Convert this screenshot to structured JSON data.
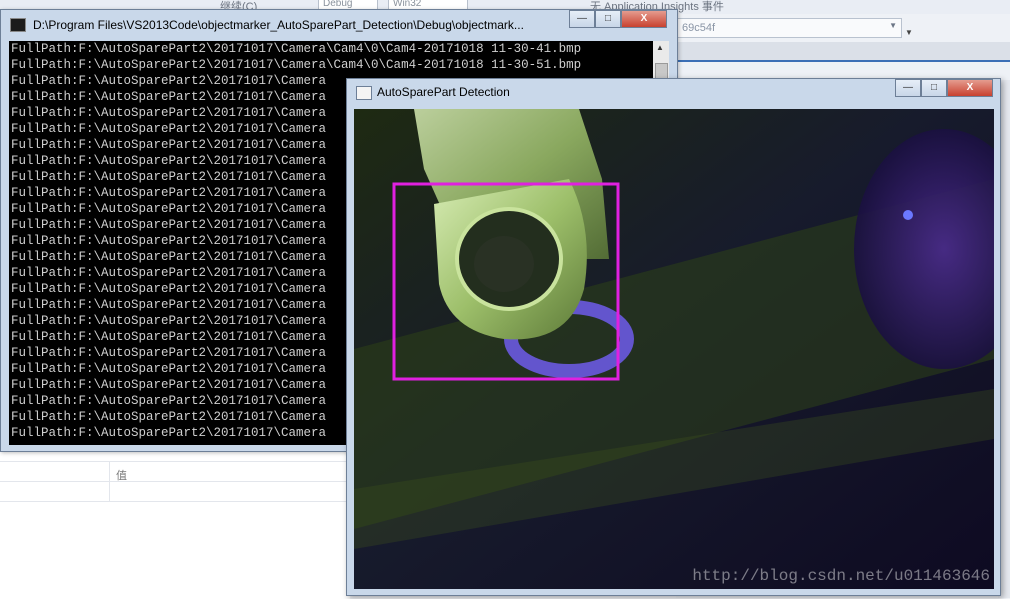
{
  "ide": {
    "toolbar_items": [
      "继续(C)",
      "Debug",
      "Win32",
      "无 Application Insights 事件"
    ],
    "combo_value": "69c54f",
    "grid_column_label": "值"
  },
  "console": {
    "title": "D:\\Program Files\\VS2013Code\\objectmarker_AutoSparePart_Detection\\Debug\\objectmark...",
    "lines": [
      "FullPath:F:\\AutoSparePart2\\20171017\\Camera\\Cam4\\0\\Cam4-20171018 11-30-41.bmp",
      "FullPath:F:\\AutoSparePart2\\20171017\\Camera\\Cam4\\0\\Cam4-20171018 11-30-51.bmp",
      "FullPath:F:\\AutoSparePart2\\20171017\\Camera",
      "FullPath:F:\\AutoSparePart2\\20171017\\Camera",
      "FullPath:F:\\AutoSparePart2\\20171017\\Camera",
      "FullPath:F:\\AutoSparePart2\\20171017\\Camera",
      "FullPath:F:\\AutoSparePart2\\20171017\\Camera",
      "FullPath:F:\\AutoSparePart2\\20171017\\Camera",
      "FullPath:F:\\AutoSparePart2\\20171017\\Camera",
      "FullPath:F:\\AutoSparePart2\\20171017\\Camera",
      "FullPath:F:\\AutoSparePart2\\20171017\\Camera",
      "FullPath:F:\\AutoSparePart2\\20171017\\Camera",
      "FullPath:F:\\AutoSparePart2\\20171017\\Camera",
      "FullPath:F:\\AutoSparePart2\\20171017\\Camera",
      "FullPath:F:\\AutoSparePart2\\20171017\\Camera",
      "FullPath:F:\\AutoSparePart2\\20171017\\Camera",
      "FullPath:F:\\AutoSparePart2\\20171017\\Camera",
      "FullPath:F:\\AutoSparePart2\\20171017\\Camera",
      "FullPath:F:\\AutoSparePart2\\20171017\\Camera",
      "FullPath:F:\\AutoSparePart2\\20171017\\Camera",
      "FullPath:F:\\AutoSparePart2\\20171017\\Camera",
      "FullPath:F:\\AutoSparePart2\\20171017\\Camera",
      "FullPath:F:\\AutoSparePart2\\20171017\\Camera",
      "FullPath:F:\\AutoSparePart2\\20171017\\Camera",
      "FullPath:F:\\AutoSparePart2\\20171017\\Camera"
    ]
  },
  "detection": {
    "title": "AutoSparePart Detection",
    "box_color": "#e020e0",
    "watermark": "http://blog.csdn.net/u011463646"
  },
  "window_buttons": {
    "minimize": "—",
    "maximize": "□",
    "close": "X"
  },
  "icons": [
    "console-app-icon",
    "image-window-icon",
    "scroll-up-icon",
    "combo-arrow-icon"
  ]
}
